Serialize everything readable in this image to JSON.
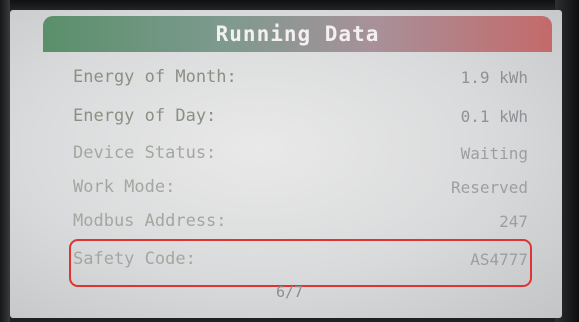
{
  "header": {
    "title": "Running Data"
  },
  "rows": [
    {
      "label": "Energy of Month:",
      "value": "1.9 kWh"
    },
    {
      "label": "Energy of Day:",
      "value": "0.1 kWh"
    },
    {
      "label": "Device Status:",
      "value": "Waiting"
    },
    {
      "label": "Work Mode:",
      "value": "Reserved"
    },
    {
      "label": "Modbus Address:",
      "value": "247"
    },
    {
      "label": "Safety Code:",
      "value": "AS4777"
    }
  ],
  "footer": {
    "page": "6/7"
  },
  "colors": {
    "highlight": "#e03434",
    "header_left": "#5a8f6a",
    "header_right": "#c46a6a"
  }
}
